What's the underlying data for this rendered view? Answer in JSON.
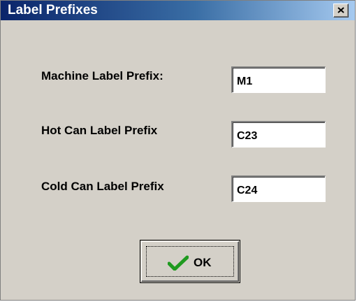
{
  "window": {
    "title": "Label Prefixes"
  },
  "fields": [
    {
      "label": "Machine Label Prefix:",
      "value": "M1"
    },
    {
      "label": "Hot Can Label Prefix",
      "value": "C23"
    },
    {
      "label": "Cold Can Label Prefix",
      "value": "C24"
    }
  ],
  "ok_button": {
    "label": "OK",
    "icon": "check-icon"
  },
  "colors": {
    "title_bar_start": "#0a246a",
    "title_bar_end": "#a6caf0",
    "dialog_bg": "#d4d0c8",
    "check": "#1f9a1f"
  }
}
